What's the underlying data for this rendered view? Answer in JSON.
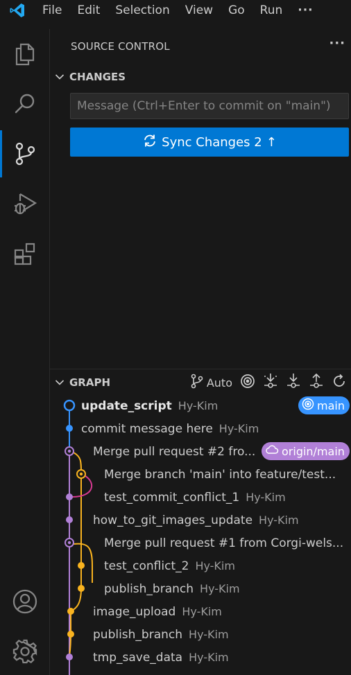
{
  "menu": {
    "items": [
      "File",
      "Edit",
      "Selection",
      "View",
      "Go",
      "Run"
    ],
    "more": "···"
  },
  "activity_bar": {
    "items": [
      {
        "name": "explorer-icon",
        "active": false
      },
      {
        "name": "search-icon",
        "active": false
      },
      {
        "name": "source-control-icon",
        "active": true
      },
      {
        "name": "run-debug-icon",
        "active": false
      },
      {
        "name": "extensions-icon",
        "active": false
      }
    ],
    "bottom": [
      "account-icon",
      "settings-gear-icon"
    ]
  },
  "panel": {
    "title": "SOURCE CONTROL",
    "more": "···"
  },
  "changes": {
    "title": "CHANGES",
    "message_placeholder": "Message (Ctrl+Enter to commit on \"main\")",
    "message_value": "",
    "sync_label": "Sync Changes 2",
    "sync_arrow": "↑"
  },
  "graph": {
    "title": "GRAPH",
    "auto_label": "Auto",
    "toolbar_icons": [
      "branch-icon",
      "target-icon",
      "fetch-icon",
      "pull-icon",
      "push-icon",
      "refresh-icon"
    ],
    "commits": [
      {
        "subject": "update_script",
        "author": "Hy-Kim",
        "badge": "main",
        "current": true
      },
      {
        "subject": "commit message here",
        "author": "Hy-Kim"
      },
      {
        "subject": "Merge pull request #2 fro...",
        "author": "",
        "badge": "origin/main"
      },
      {
        "subject": "Merge branch 'main' into feature/test...",
        "author": ""
      },
      {
        "subject": "test_commit_conflict_1",
        "author": "Hy-Kim"
      },
      {
        "subject": "how_to_git_images_update",
        "author": "Hy-Kim"
      },
      {
        "subject": "Merge pull request #1 from Corgi-wels...",
        "author": ""
      },
      {
        "subject": "test_conflict_2",
        "author": "Hy-Kim"
      },
      {
        "subject": "publish_branch",
        "author": "Hy-Kim"
      },
      {
        "subject": "image_upload",
        "author": "Hy-Kim"
      },
      {
        "subject": "publish_branch",
        "author": "Hy-Kim"
      },
      {
        "subject": "tmp_save_data",
        "author": "Hy-Kim"
      }
    ]
  },
  "colors": {
    "accent": "#0078d4",
    "lane_blue": "#3794ff",
    "lane_purple": "#b180d7",
    "lane_orange": "#f9b31f",
    "lane_pink": "#d63a92"
  }
}
